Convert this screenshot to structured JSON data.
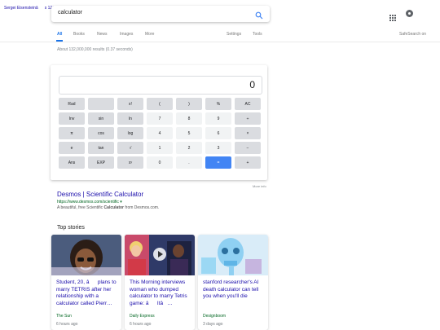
{
  "logo_alt": "Sergei Eisensteinâs 120th birthday",
  "search": {
    "query": "calculator"
  },
  "tabs": {
    "all": "All",
    "books": "Books",
    "news": "News",
    "images": "Images",
    "more": "More",
    "settings": "Settings",
    "tools": "Tools"
  },
  "safesearch": "SafeSearch on",
  "stats": "About 132,000,000 results (0.37 seconds)",
  "calculator": {
    "display": "0",
    "keys": [
      [
        "Rad",
        "",
        "x!",
        "(",
        ")",
        "%",
        "AC"
      ],
      [
        "Inv",
        "sin",
        "ln",
        "7",
        "8",
        "9",
        "÷"
      ],
      [
        "π",
        "cos",
        "log",
        "4",
        "5",
        "6",
        "×"
      ],
      [
        "e",
        "tan",
        "√",
        "1",
        "2",
        "3",
        "−"
      ],
      [
        "Ans",
        "EXP",
        "xʸ",
        "0",
        ".",
        "=",
        "+"
      ]
    ],
    "more_info": "More info"
  },
  "result": {
    "title": "Desmos | Scientific Calculator",
    "url": "https://www.desmos.com/scientific",
    "url_arrow": "▾",
    "snippet_pre": "A beautiful, free Scientific ",
    "snippet_bold": "Calculator",
    "snippet_post": " from Desmos.com."
  },
  "top_stories": {
    "title": "Top stories",
    "cards": [
      {
        "headline": "Student, 20, âplans to marry TETRIS after her relationship with a calculator called Pierr…",
        "source": "The Sun",
        "time": "6 hours ago"
      },
      {
        "headline": "This Morning interviews woman who dumped calculator to marry Tetris game: âItâ…",
        "source": "Daily Express",
        "time": "6 hours ago"
      },
      {
        "headline": "stanford researcher's AI death calculator can tell you when you'll die",
        "source": "Designboom",
        "time": "3 days ago"
      }
    ]
  },
  "colors": {
    "link": "#1a0dab",
    "url": "#006621",
    "accent": "#1a73e8",
    "equals": "#4285f4"
  }
}
